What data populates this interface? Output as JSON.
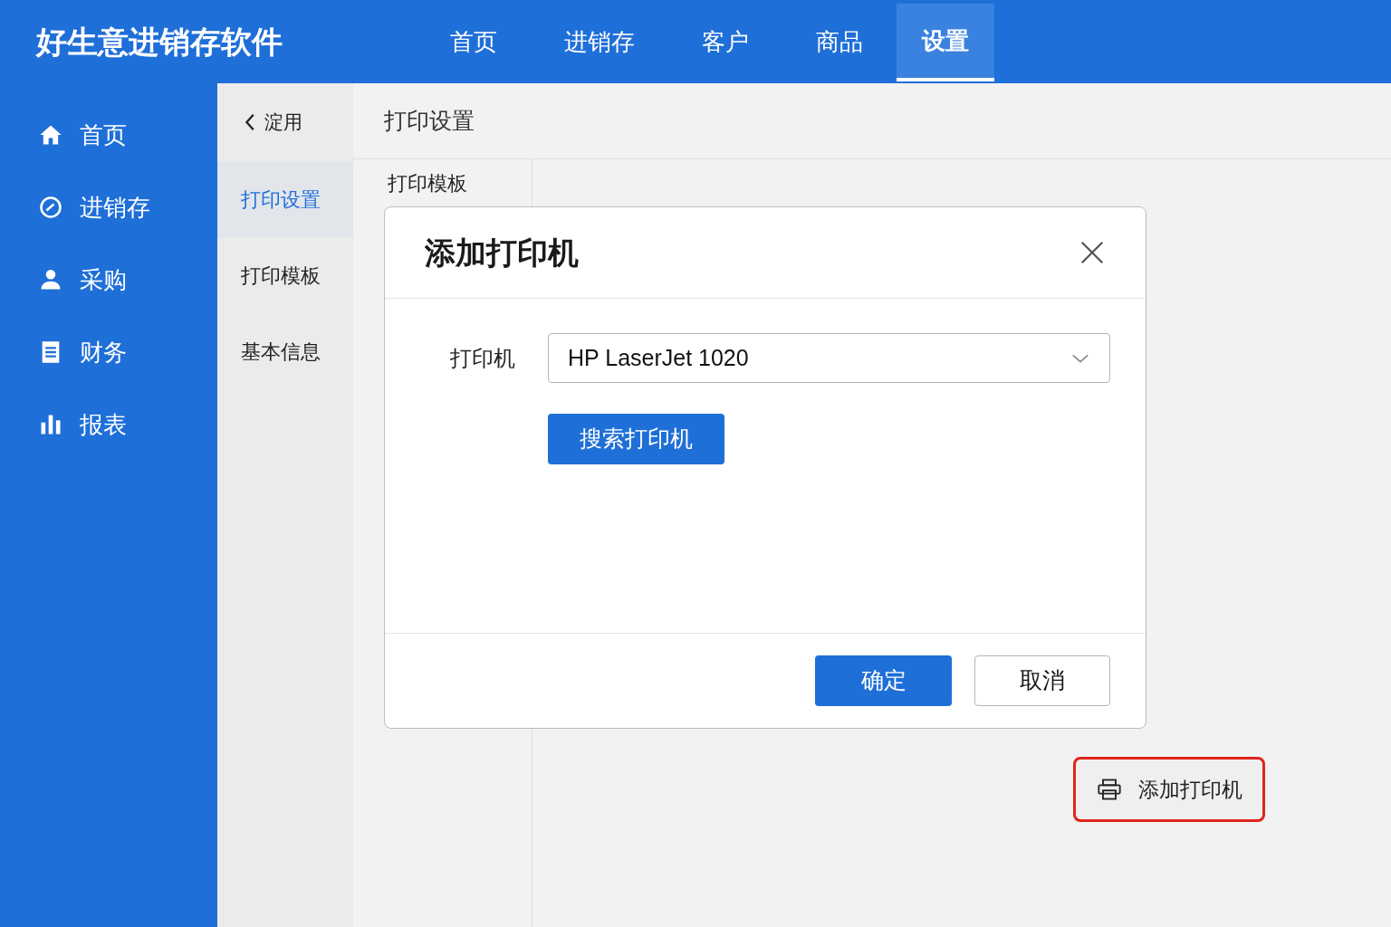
{
  "app_title": "好生意进销存软件",
  "tabs": [
    {
      "label": "首页",
      "selected": false
    },
    {
      "label": "进销存",
      "selected": false
    },
    {
      "label": "客户",
      "selected": false
    },
    {
      "label": "商品",
      "selected": false
    },
    {
      "label": "设置",
      "selected": true
    }
  ],
  "sidebar": {
    "items": [
      {
        "label": "首页",
        "kind": "home"
      },
      {
        "label": "进销存",
        "kind": "gauge"
      },
      {
        "label": "采购",
        "kind": "user"
      },
      {
        "label": "财务",
        "kind": "doc"
      },
      {
        "label": "报表",
        "kind": "chart"
      }
    ]
  },
  "subnav": {
    "back": "淀用",
    "items": [
      {
        "label": "打印设置",
        "selected": true
      },
      {
        "label": "打印模板",
        "selected": false
      },
      {
        "label": "基本信息",
        "selected": false
      }
    ]
  },
  "page_title": "打印设置",
  "section_label": "打印模板",
  "dialog": {
    "title": "添加打印机",
    "field_label": "打印机",
    "field_value": "HP LaserJet 1020",
    "search_button": "搜索打印机",
    "ok": "确定",
    "cancel": "取消"
  },
  "add_printer_button": {
    "label": "添加打印机",
    "highlighted": true
  }
}
